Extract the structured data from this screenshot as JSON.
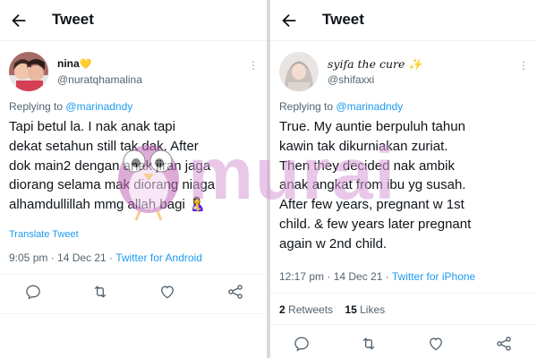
{
  "left": {
    "header_title": "Tweet",
    "display_name": "nina",
    "name_emoji": "💛",
    "handle": "@nuratqhamalina",
    "replying_prefix": "Replying to",
    "replying_to": "@marinadndy",
    "body_lines": [
      "Tapi betul la. I nak anak tapi",
      "dekat setahun still tak dak. After",
      "dok main2 dengan anak jiran jaga",
      "diorang selama mak diorang niaga",
      "alhamdullillah mmg allah bagi 🤱"
    ],
    "translate_label": "Translate Tweet",
    "time": "9:05 pm · 14 Dec 21 ·",
    "source": "Twitter for Android"
  },
  "right": {
    "header_title": "Tweet",
    "display_name": "syifa the cure",
    "name_emoji": "✨",
    "handle": "@shifaxxi",
    "replying_prefix": "Replying to",
    "replying_to": "@marinadndy",
    "body_lines": [
      "True. My auntie berpuluh tahun",
      "kawin tak dikurniakan zuriat.",
      "Then they decided nak ambik",
      "anak angkat from ibu yg susah.",
      "After few years, pregnant w 1st",
      "child. & few years later pregnant",
      "again w 2nd child."
    ],
    "time": "12:17 pm · 14 Dec 21 ·",
    "source": "Twitter for iPhone",
    "retweets_count": "2",
    "retweets_label": "Retweets",
    "likes_count": "15",
    "likes_label": "Likes"
  },
  "watermark_text": "murai",
  "colors": {
    "accent": "#1d9bf0",
    "muted": "#536471",
    "watermark": "#d79bd6"
  },
  "icons": [
    "back-arrow-icon",
    "more-icon",
    "reply-icon",
    "retweet-icon",
    "like-icon",
    "share-icon"
  ]
}
